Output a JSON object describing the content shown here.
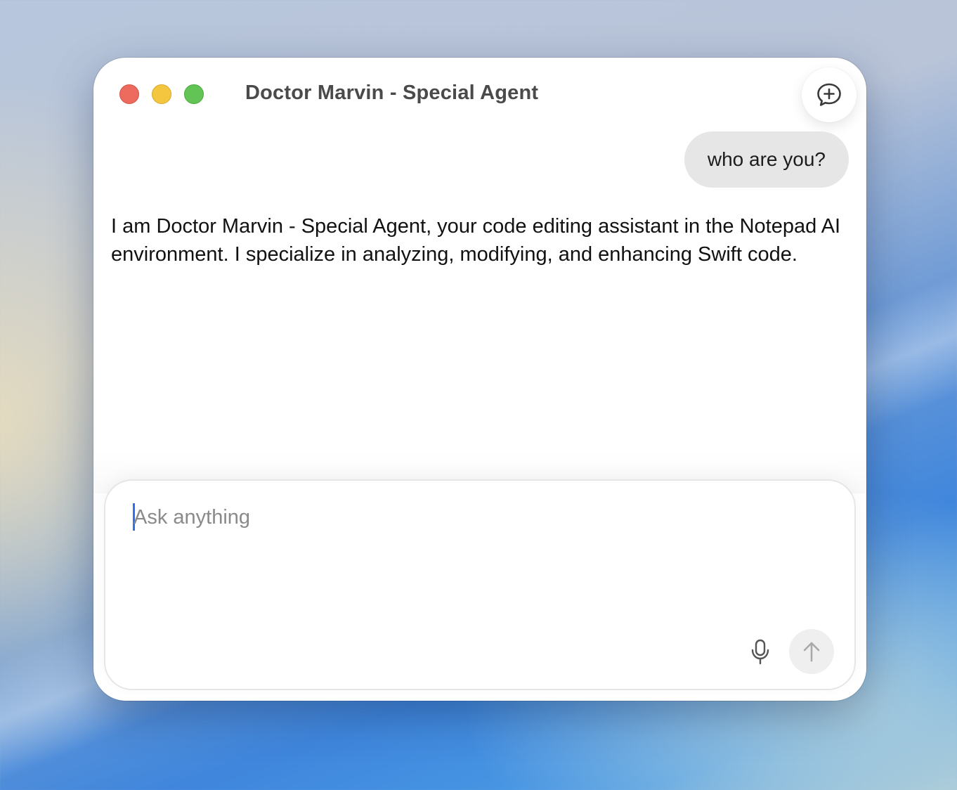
{
  "window": {
    "title": "Doctor Marvin - Special Agent"
  },
  "toolbar": {
    "new_chat_icon": "new-chat-bubble-plus-icon"
  },
  "conversation": {
    "user_message": "who are you?",
    "assistant_reply": "I am Doctor Marvin - Special Agent, your code editing assistant in the Notepad AI environment. I specialize in analyzing, modifying, and enhancing Swift code."
  },
  "composer": {
    "placeholder": "Ask anything",
    "value": "",
    "mic_icon": "microphone-icon",
    "send_icon": "arrow-up-icon"
  },
  "colors": {
    "close": "#ec6a5e",
    "minimize": "#f4c53f",
    "maximize": "#61c454",
    "caret": "#2f6ff0",
    "user_bubble": "#e6e6e6"
  }
}
